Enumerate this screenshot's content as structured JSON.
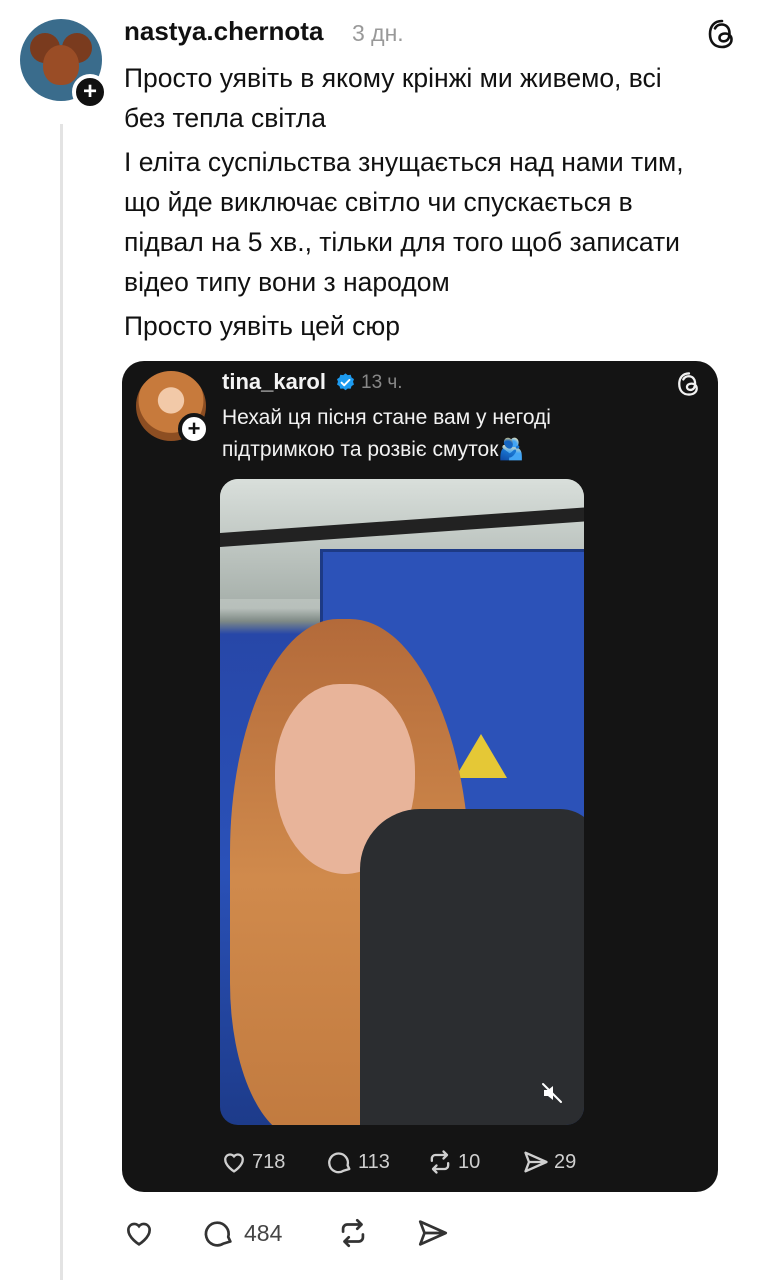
{
  "post": {
    "username": "nastya.chernota",
    "time": "3 дн.",
    "paragraphs": [
      "Просто уявіть в якому крінжі ми живемо, всі",
      "без тепла світла",
      "І еліта суспільства знущається над нами тим,",
      "що йде виключає світло чи спускається в",
      "підвал на 5 хв., тільки для того щоб записати",
      "відео типу вони з народом",
      "Просто уявіть цей сюр"
    ],
    "actions": {
      "likes": "",
      "replies": "484",
      "reposts": "",
      "shares": ""
    }
  },
  "quoted": {
    "username": "tina_karol",
    "time": "13 ч.",
    "text_line1": "Нехай ця пісня стане вам у негоді",
    "text_line2": "підтримкою та розвіє смуток🫂",
    "likes": "718",
    "replies": "113",
    "reposts": "10",
    "shares": "29"
  },
  "icons": {
    "app_logo": "threads-icon",
    "verified": "verified-badge-icon",
    "mute": "muted-speaker-icon"
  },
  "colors": {
    "verified_blue": "#1d9bf0",
    "card_bg": "#141414"
  }
}
